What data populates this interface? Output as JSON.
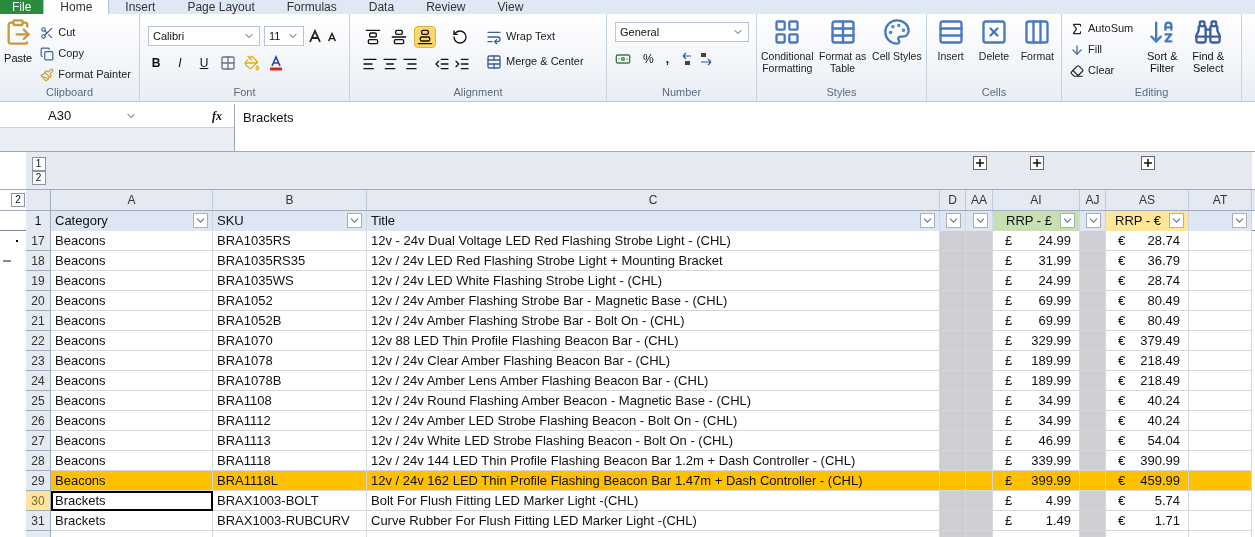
{
  "tabs": [
    {
      "label": "File",
      "kind": "file",
      "selected": false
    },
    {
      "label": "Home",
      "kind": "tab",
      "selected": true
    },
    {
      "label": "Insert",
      "kind": "tab",
      "selected": false
    },
    {
      "label": "Page Layout",
      "kind": "tab",
      "selected": false
    },
    {
      "label": "Formulas",
      "kind": "tab",
      "selected": false
    },
    {
      "label": "Data",
      "kind": "tab",
      "selected": false
    },
    {
      "label": "Review",
      "kind": "tab",
      "selected": false
    },
    {
      "label": "View",
      "kind": "tab",
      "selected": false
    }
  ],
  "ribbon": {
    "clipboard": {
      "label": "Clipboard",
      "paste": "Paste",
      "cut": "Cut",
      "copy": "Copy",
      "format_painter": "Format Painter"
    },
    "font": {
      "label": "Font",
      "font_name": "Calibri",
      "font_size": "11",
      "bold": "B",
      "italic": "I",
      "underline": "U"
    },
    "alignment": {
      "label": "Alignment",
      "vertical": [
        {
          "selected": false
        },
        {
          "selected": false
        },
        {
          "selected": true
        }
      ],
      "wrap_text": "Wrap Text",
      "merge_center": "Merge & Center"
    },
    "number": {
      "label": "Number",
      "format": "General",
      "percent": "%",
      "comma": ","
    },
    "styles": {
      "label": "Styles",
      "buttons": [
        "Conditional Formatting",
        "Format as Table",
        "Cell Styles"
      ]
    },
    "cells": {
      "label": "Cells",
      "buttons": [
        "Insert",
        "Delete",
        "Format"
      ]
    },
    "editing": {
      "label": "Editing",
      "autosum": "AutoSum",
      "fill": "Fill",
      "clear": "Clear",
      "sort_filter": "Sort & Filter",
      "find_select": "Find & Select"
    }
  },
  "formula_bar": {
    "name_box": "A30",
    "function_label": "fx",
    "content": "Brackets"
  },
  "outline": {
    "levels": [
      "1",
      "2"
    ],
    "row_level": "2"
  },
  "header_row_number": "1",
  "columns": [
    {
      "letter": "A",
      "kind": "normal",
      "header": "Category",
      "expand": false
    },
    {
      "letter": "B",
      "kind": "normal",
      "header": "SKU",
      "expand": false
    },
    {
      "letter": "C",
      "kind": "normal",
      "header": "Title",
      "expand": false
    },
    {
      "letter": "D",
      "kind": "grey",
      "expand": false
    },
    {
      "letter": "AA",
      "kind": "grey",
      "expand": true
    },
    {
      "letter": "AI",
      "kind": "currency",
      "header": "RRP - £",
      "color": "#c6e0b4",
      "expand": true
    },
    {
      "letter": "AJ",
      "kind": "grey",
      "expand": false
    },
    {
      "letter": "AS",
      "kind": "currency",
      "header": "RRP - €",
      "color": "#ffe699",
      "expand": true
    },
    {
      "letter": "AT",
      "kind": "normal",
      "expand": false
    }
  ],
  "rows": [
    {
      "number": "17",
      "category": "Beacons",
      "sku": "BRA1035RS",
      "title": "12v - 24v Dual Voltage LED Red Flashing Strobe Light - (CHL)",
      "gbp_symbol": "£",
      "gbp": "24.99",
      "eur_symbol": "€",
      "eur": "28.74",
      "highlighted": false,
      "active": false
    },
    {
      "number": "18",
      "category": "Beacons",
      "sku": "BRA1035RS35",
      "title": "12v / 24v LED Red Flashing Strobe Light + Mounting Bracket",
      "gbp_symbol": "£",
      "gbp": "31.99",
      "eur_symbol": "€",
      "eur": "36.79",
      "highlighted": false,
      "active": false
    },
    {
      "number": "19",
      "category": "Beacons",
      "sku": "BRA1035WS",
      "title": "12v / 24v LED White Flashing Strobe Light - (CHL)",
      "gbp_symbol": "£",
      "gbp": "24.99",
      "eur_symbol": "€",
      "eur": "28.74",
      "highlighted": false,
      "active": false
    },
    {
      "number": "20",
      "category": "Beacons",
      "sku": "BRA1052",
      "title": "12v / 24v Amber Flashing Strobe Bar - Magnetic Base - (CHL)",
      "gbp_symbol": "£",
      "gbp": "69.99",
      "eur_symbol": "€",
      "eur": "80.49",
      "highlighted": false,
      "active": false
    },
    {
      "number": "21",
      "category": "Beacons",
      "sku": "BRA1052B",
      "title": "12v / 24v Amber Flashing Strobe Bar - Bolt On - (CHL)",
      "gbp_symbol": "£",
      "gbp": "69.99",
      "eur_symbol": "€",
      "eur": "80.49",
      "highlighted": false,
      "active": false
    },
    {
      "number": "22",
      "category": "Beacons",
      "sku": "BRA1070",
      "title": "12v 88 LED Thin Profile Flashing Beacon Bar - (CHL)",
      "gbp_symbol": "£",
      "gbp": "329.99",
      "eur_symbol": "€",
      "eur": "379.49",
      "highlighted": false,
      "active": false
    },
    {
      "number": "23",
      "category": "Beacons",
      "sku": "BRA1078",
      "title": "12v / 24v Clear Amber Flashing Beacon Bar - (CHL)",
      "gbp_symbol": "£",
      "gbp": "189.99",
      "eur_symbol": "€",
      "eur": "218.49",
      "highlighted": false,
      "active": false
    },
    {
      "number": "24",
      "category": "Beacons",
      "sku": "BRA1078B",
      "title": "12v / 24v Amber Lens Amber Flashing Beacon Bar - (CHL)",
      "gbp_symbol": "£",
      "gbp": "189.99",
      "eur_symbol": "€",
      "eur": "218.49",
      "highlighted": false,
      "active": false
    },
    {
      "number": "25",
      "category": "Beacons",
      "sku": "BRA1108",
      "title": "12v / 24v Round Flashing Amber Beacon - Magnetic Base - (CHL)",
      "gbp_symbol": "£",
      "gbp": "34.99",
      "eur_symbol": "€",
      "eur": "40.24",
      "highlighted": false,
      "active": false
    },
    {
      "number": "26",
      "category": "Beacons",
      "sku": "BRA1112",
      "title": "12v / 24v Amber LED Strobe Flashing Beacon - Bolt On - (CHL)",
      "gbp_symbol": "£",
      "gbp": "34.99",
      "eur_symbol": "€",
      "eur": "40.24",
      "highlighted": false,
      "active": false
    },
    {
      "number": "27",
      "category": "Beacons",
      "sku": "BRA1113",
      "title": "12v / 24v White LED Strobe Flashing Beacon - Bolt On - (CHL)",
      "gbp_symbol": "£",
      "gbp": "46.99",
      "eur_symbol": "€",
      "eur": "54.04",
      "highlighted": false,
      "active": false
    },
    {
      "number": "28",
      "category": "Beacons",
      "sku": "BRA1118",
      "title": "12v / 24v 144 LED Thin Profile Flashing Beacon Bar 1.2m + Dash Controller - (CHL)",
      "gbp_symbol": "£",
      "gbp": "339.99",
      "eur_symbol": "€",
      "eur": "390.99",
      "highlighted": false,
      "active": false
    },
    {
      "number": "29",
      "category": "Beacons",
      "sku": "BRA1118L",
      "title": "12v / 24v 162 LED Thin Profile Flashing Beacon Bar 1.47m + Dash Controller - (CHL)",
      "gbp_symbol": "£",
      "gbp": "399.99",
      "eur_symbol": "€",
      "eur": "459.99",
      "highlighted": true,
      "active": false
    },
    {
      "number": "30",
      "category": "Brackets",
      "sku": "BRAX1003-BOLT",
      "title": "Bolt For Flush Fitting LED Marker Light -(CHL)",
      "gbp_symbol": "£",
      "gbp": "4.99",
      "eur_symbol": "€",
      "eur": "5.74",
      "highlighted": false,
      "active": true
    },
    {
      "number": "31",
      "category": "Brackets",
      "sku": "BRAX1003-RUBCURV",
      "title": "Curve Rubber For Flush Fitting LED Marker Light -(CHL)",
      "gbp_symbol": "£",
      "gbp": "1.49",
      "eur_symbol": "€",
      "eur": "1.71",
      "highlighted": false,
      "active": false
    }
  ]
}
